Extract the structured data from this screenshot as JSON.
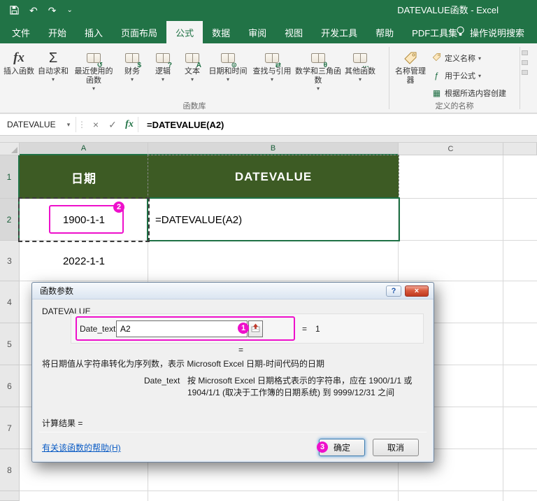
{
  "titlebar": {
    "title": "DATEVALUE函数 - Excel"
  },
  "icons": {
    "undo": "↶",
    "redo": "↷",
    "qat_menu": "⌄",
    "dropdown": "▾",
    "namebox_dropdown": "▾",
    "fbar_handle": "⋮",
    "formula_cancel": "×",
    "formula_enter": "✓",
    "formula_fx": "fx",
    "insert_fx": "fx",
    "autosum_sigma": "Σ",
    "use_in_formula": "ƒ",
    "create_from_selection": "▦",
    "help": "?",
    "close": "×"
  },
  "ribbon": {
    "tabs": [
      "文件",
      "开始",
      "插入",
      "页面布局",
      "公式",
      "数据",
      "审阅",
      "视图",
      "开发工具",
      "帮助",
      "PDF工具集"
    ],
    "search_label": "操作说明搜索",
    "function_library": {
      "group_label": "函数库",
      "insert_function": "插入函数",
      "autosum": "自动求和",
      "buttons": [
        {
          "label": "最近使用的函数",
          "glyph": "↺"
        },
        {
          "label": "财务",
          "glyph": "$"
        },
        {
          "label": "逻辑",
          "glyph": "?"
        },
        {
          "label": "文本",
          "glyph": "A"
        },
        {
          "label": "日期和时间",
          "glyph": "⊙"
        },
        {
          "label": "查找与引用",
          "glyph": "⇄"
        },
        {
          "label": "数学和三角函数",
          "glyph": "θ"
        },
        {
          "label": "其他函数",
          "glyph": "…"
        }
      ]
    },
    "defined_names": {
      "group_label": "定义的名称",
      "name_manager": "名称管理器",
      "items": [
        "定义名称",
        "用于公式",
        "根据所选内容创建"
      ]
    }
  },
  "formula_bar": {
    "name_box": "DATEVALUE",
    "formula": "=DATEVALUE(A2)"
  },
  "sheet": {
    "columns": [
      "A",
      "B",
      "C"
    ],
    "rows": [
      "1",
      "2",
      "3",
      "4",
      "5",
      "6",
      "7",
      "8"
    ],
    "cells": {
      "a1": "日期",
      "b1": "DATEVALUE",
      "a2": "1900-1-1",
      "b2": "=DATEVALUE(A2)",
      "a3": "2022-1-1"
    }
  },
  "dialog": {
    "title": "函数参数",
    "function_name": "DATEVALUE",
    "param_label": "Date_text",
    "param_value": "A2",
    "param_equals": "=",
    "param_result": "1",
    "formula_equals": "=",
    "description": "将日期值从字符串转化为序列数，表示 Microsoft Excel 日期-时间代码的日期",
    "help_param_label": "Date_text",
    "help_param_text": "按 Microsoft Excel 日期格式表示的字符串，应在 1900/1/1 或 1904/1/1 (取决于工作簿的日期系统) 到 9999/12/31 之间",
    "result_label": "计算结果 =",
    "help_link": "有关该函数的帮助(H)",
    "ok": "确定",
    "cancel": "取消"
  },
  "annotations": {
    "step1": "1",
    "step2": "2",
    "step3": "3",
    "highlight_color": "#ee10cb"
  },
  "colors": {
    "excel_green": "#217346",
    "table_header_green": "#3d5b24"
  }
}
